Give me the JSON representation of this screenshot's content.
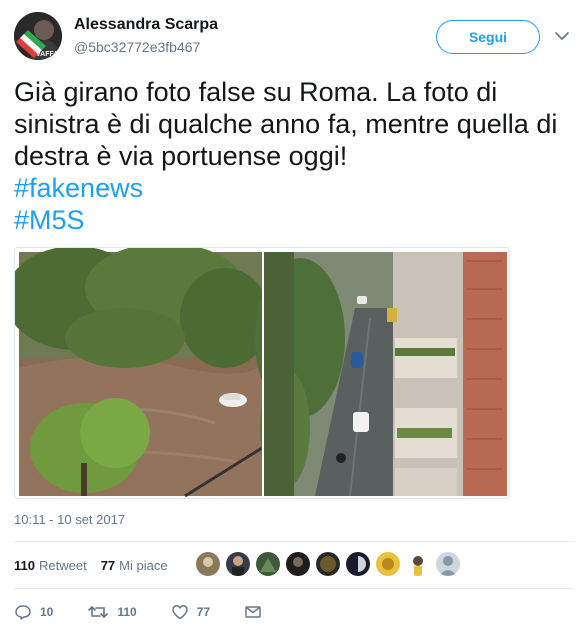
{
  "user": {
    "name": "Alessandra Scarpa",
    "handle": "@5bc32772e3fb467",
    "avatar_caption": "VAFFA"
  },
  "follow_button": {
    "label": "Segui"
  },
  "tweet": {
    "lines": [
      "Già girano foto false su Roma. La foto di",
      "sinistra è di qualche anno fa, mentre quella di",
      "destra è via portuense oggi!"
    ],
    "hashtags": [
      "#fakenews",
      "#M5S"
    ]
  },
  "media": {
    "left_alt": "flooded street with trees and submerged car",
    "right_alt": "wet street between buildings with cars"
  },
  "timestamp": "10:11 - 10 set 2017",
  "stats": {
    "retweets_count": "110",
    "retweets_label": "Retweet",
    "likes_count": "77",
    "likes_label": "Mi piace"
  },
  "likers_count_shown": 9,
  "actions": {
    "reply_count": "10",
    "retweet_count": "110",
    "like_count": "77"
  },
  "colors": {
    "accent": "#1da1f2",
    "secondary_text": "#657786",
    "primary_text": "#14171a"
  }
}
